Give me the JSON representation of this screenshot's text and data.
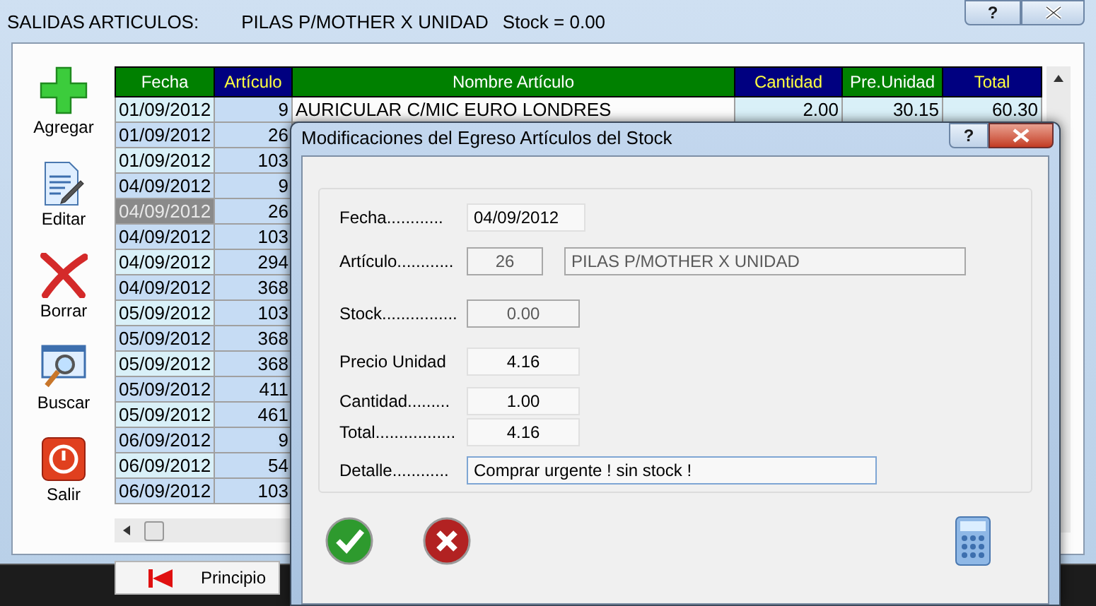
{
  "window": {
    "title": "SALIDAS ARTICULOS:",
    "article": "PILAS P/MOTHER X UNIDAD",
    "stock": "Stock = 0.00",
    "help": "?"
  },
  "toolbar": [
    {
      "label": "Agregar",
      "kind": "add"
    },
    {
      "label": "Editar",
      "kind": "edit"
    },
    {
      "label": "Borrar",
      "kind": "delete"
    },
    {
      "label": "Buscar",
      "kind": "search"
    },
    {
      "label": "Salir",
      "kind": "exit"
    }
  ],
  "table": {
    "columns": [
      {
        "label": "Fecha",
        "color": "#008000"
      },
      {
        "label": "Artículo",
        "color": "#000080"
      },
      {
        "label": "Nombre Artículo",
        "color": "#008000"
      },
      {
        "label": "Cantidad",
        "color": "#000080"
      },
      {
        "label": "Pre.Unidad",
        "color": "#008000"
      },
      {
        "label": "Total",
        "color": "#000080"
      }
    ],
    "rows": [
      {
        "cells": [
          "01/09/2012",
          "9",
          "AURICULAR C/MIC EURO LONDRES",
          "2.00",
          "30.15",
          "60.30"
        ],
        "selected": false
      },
      {
        "cells": [
          "01/09/2012",
          "26"
        ],
        "selected": false
      },
      {
        "cells": [
          "01/09/2012",
          "103"
        ],
        "selected": false
      },
      {
        "cells": [
          "04/09/2012",
          "9"
        ],
        "selected": false
      },
      {
        "cells": [
          "04/09/2012",
          "26"
        ],
        "selected": true
      },
      {
        "cells": [
          "04/09/2012",
          "103"
        ],
        "selected": false
      },
      {
        "cells": [
          "04/09/2012",
          "294"
        ],
        "selected": false
      },
      {
        "cells": [
          "04/09/2012",
          "368"
        ],
        "selected": false
      },
      {
        "cells": [
          "05/09/2012",
          "103"
        ],
        "selected": false
      },
      {
        "cells": [
          "05/09/2012",
          "368"
        ],
        "selected": false
      },
      {
        "cells": [
          "05/09/2012",
          "368"
        ],
        "selected": false
      },
      {
        "cells": [
          "05/09/2012",
          "411"
        ],
        "selected": false
      },
      {
        "cells": [
          "05/09/2012",
          "461"
        ],
        "selected": false
      },
      {
        "cells": [
          "06/09/2012",
          "9"
        ],
        "selected": false
      },
      {
        "cells": [
          "06/09/2012",
          "54"
        ],
        "selected": false
      },
      {
        "cells": [
          "06/09/2012",
          "103"
        ],
        "selected": false
      }
    ]
  },
  "nav_button": {
    "label": "Principio"
  },
  "dialog": {
    "title": "Modificaciones del Egreso Artículos del Stock",
    "help": "?",
    "fields": [
      {
        "label": "Fecha............",
        "kind": "date",
        "value": "04/09/2012",
        "disabled": false
      },
      {
        "label": "Artículo............",
        "kind": "article",
        "value": "26",
        "name": "PILAS P/MOTHER X UNIDAD",
        "disabled": true
      },
      {
        "label": "Stock................",
        "kind": "number",
        "value": "0.00",
        "disabled": true
      },
      {
        "label": "Precio Unidad",
        "kind": "number",
        "value": "4.16",
        "disabled": false
      },
      {
        "label": "Cantidad.........",
        "kind": "number",
        "value": "1.00",
        "disabled": false
      },
      {
        "label": "Total.................",
        "kind": "number",
        "value": "4.16",
        "disabled": false
      },
      {
        "label": "Detalle............",
        "kind": "text",
        "value": "Comprar urgente ! sin stock !",
        "disabled": false
      }
    ]
  }
}
